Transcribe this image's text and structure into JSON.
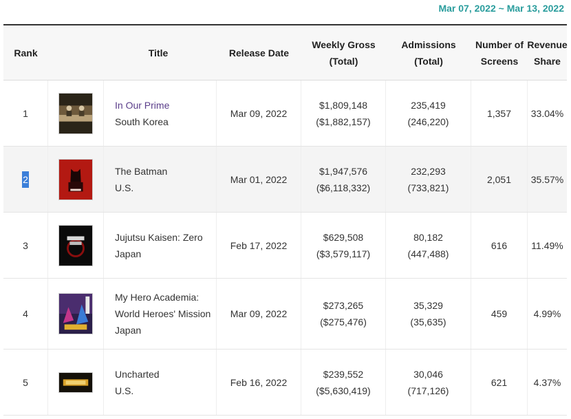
{
  "date_range": "Mar 07, 2022 ~ Mar 13, 2022",
  "headers": {
    "rank": "Rank",
    "title": "Title",
    "release_date": "Release Date",
    "weekly_gross_1": "Weekly Gross",
    "weekly_gross_2": "(Total)",
    "admissions_1": "Admissions",
    "admissions_2": "(Total)",
    "screens_1": "Number of",
    "screens_2": "Screens",
    "share_1": "Revenue",
    "share_2": "Share"
  },
  "rows": [
    {
      "rank": "1",
      "title": "In Our Prime",
      "country": "South Korea",
      "release_date": "Mar 09, 2022",
      "weekly_gross": "$1,809,148",
      "total_gross": "($1,882,157)",
      "admissions": "235,419",
      "total_admissions": "(246,220)",
      "screens": "1,357",
      "share": "33.04%"
    },
    {
      "rank": "2",
      "title": "The Batman",
      "country": "U.S.",
      "release_date": "Mar 01, 2022",
      "weekly_gross": "$1,947,576",
      "total_gross": "($6,118,332)",
      "admissions": "232,293",
      "total_admissions": "(733,821)",
      "screens": "2,051",
      "share": "35.57%"
    },
    {
      "rank": "3",
      "title": "Jujutsu Kaisen: Zero",
      "country": "Japan",
      "release_date": "Feb 17, 2022",
      "weekly_gross": "$629,508",
      "total_gross": "($3,579,117)",
      "admissions": "80,182",
      "total_admissions": "(447,488)",
      "screens": "616",
      "share": "11.49%"
    },
    {
      "rank": "4",
      "title_line1": "My Hero Academia:",
      "title_line2": "World Heroes' Mission",
      "country": "Japan",
      "release_date": "Mar 09, 2022",
      "weekly_gross": "$273,265",
      "total_gross": "($275,476)",
      "admissions": "35,329",
      "total_admissions": "(35,635)",
      "screens": "459",
      "share": "4.99%"
    },
    {
      "rank": "5",
      "title": "Uncharted",
      "country": "U.S.",
      "release_date": "Feb 16, 2022",
      "weekly_gross": "$239,552",
      "total_gross": "($5,630,419)",
      "admissions": "30,046",
      "total_admissions": "(717,126)",
      "screens": "621",
      "share": "4.37%"
    }
  ],
  "colors": {
    "accent": "#2a9d9d",
    "link": "#5a3d8a",
    "selection": "#3b7fd9"
  }
}
